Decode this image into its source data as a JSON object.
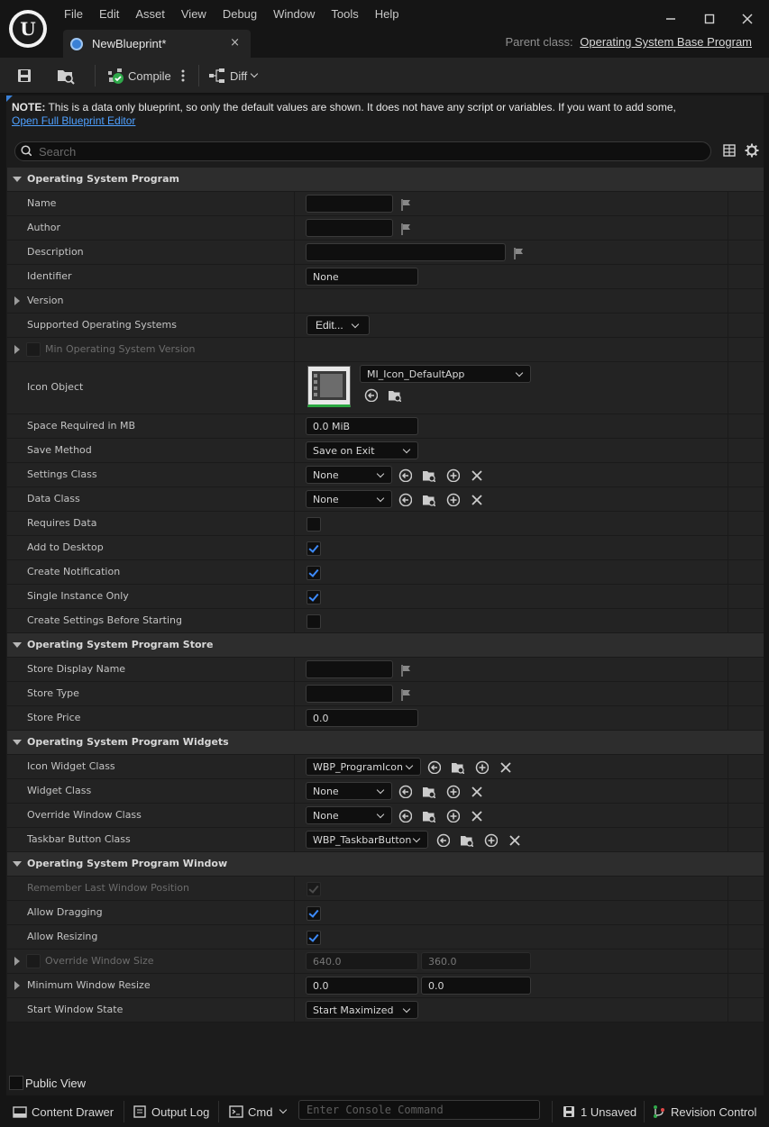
{
  "menu": [
    "File",
    "Edit",
    "Asset",
    "View",
    "Debug",
    "Window",
    "Tools",
    "Help"
  ],
  "tab": {
    "label": "NewBlueprint*",
    "close": "×"
  },
  "parent_class": {
    "label": "Parent class:",
    "value": "Operating System Base Program"
  },
  "toolbar": {
    "compile_label": "Compile",
    "diff_label": "Diff"
  },
  "note": {
    "bold": "NOTE:",
    "text": " This is a data only blueprint, so only the default values are shown.  It does not have any script or variables.  If you want to add some,",
    "link": "Open Full Blueprint Editor"
  },
  "search": {
    "placeholder": "Search"
  },
  "sections": {
    "program": "Operating System Program",
    "store": "Operating System Program Store",
    "widgets": "Operating System Program Widgets",
    "window": "Operating System Program Window"
  },
  "props": {
    "name": {
      "label": "Name",
      "value": ""
    },
    "author": {
      "label": "Author",
      "value": ""
    },
    "description": {
      "label": "Description",
      "value": ""
    },
    "identifier": {
      "label": "Identifier",
      "value": "None"
    },
    "version": {
      "label": "Version"
    },
    "supported_os": {
      "label": "Supported Operating Systems",
      "value": "Edit..."
    },
    "min_os": {
      "label": "Min Operating System Version"
    },
    "icon_object": {
      "label": "Icon Object",
      "value": "MI_Icon_DefaultApp"
    },
    "space_required": {
      "label": "Space Required in MB",
      "value": "0.0 MiB"
    },
    "save_method": {
      "label": "Save Method",
      "value": "Save on Exit"
    },
    "settings_class": {
      "label": "Settings Class",
      "value": "None"
    },
    "data_class": {
      "label": "Data Class",
      "value": "None"
    },
    "requires_data": {
      "label": "Requires Data",
      "checked": false
    },
    "add_to_desktop": {
      "label": "Add to Desktop",
      "checked": true
    },
    "create_notification": {
      "label": "Create Notification",
      "checked": true
    },
    "single_instance": {
      "label": "Single Instance Only",
      "checked": true
    },
    "create_settings": {
      "label": "Create Settings Before Starting",
      "checked": false
    },
    "store_display_name": {
      "label": "Store Display Name",
      "value": ""
    },
    "store_type": {
      "label": "Store Type",
      "value": ""
    },
    "store_price": {
      "label": "Store Price",
      "value": "0.0"
    },
    "icon_widget_class": {
      "label": "Icon Widget Class",
      "value": "WBP_ProgramIcon"
    },
    "widget_class": {
      "label": "Widget Class",
      "value": "None"
    },
    "override_window_class": {
      "label": "Override Window Class",
      "value": "None"
    },
    "taskbar_button_class": {
      "label": "Taskbar Button Class",
      "value": "WBP_TaskbarButton"
    },
    "remember_position": {
      "label": "Remember Last Window Position",
      "checked": true
    },
    "allow_dragging": {
      "label": "Allow Dragging",
      "checked": true
    },
    "allow_resizing": {
      "label": "Allow Resizing",
      "checked": true
    },
    "override_window_size": {
      "label": "Override Window Size",
      "x": "640.0",
      "y": "360.0"
    },
    "min_window_resize": {
      "label": "Minimum Window Resize",
      "x": "0.0",
      "y": "0.0"
    },
    "start_window_state": {
      "label": "Start Window State",
      "value": "Start Maximized"
    }
  },
  "public_view": "Public View",
  "statusbar": {
    "content_drawer": "Content Drawer",
    "output_log": "Output Log",
    "cmd": "Cmd",
    "console_placeholder": "Enter Console Command",
    "unsaved": "1 Unsaved",
    "revision_control": "Revision Control"
  },
  "colors": {
    "accent": "#3d8bfd",
    "link": "#4ea0ff",
    "panel": "#232323",
    "section": "#2d2d2d"
  }
}
